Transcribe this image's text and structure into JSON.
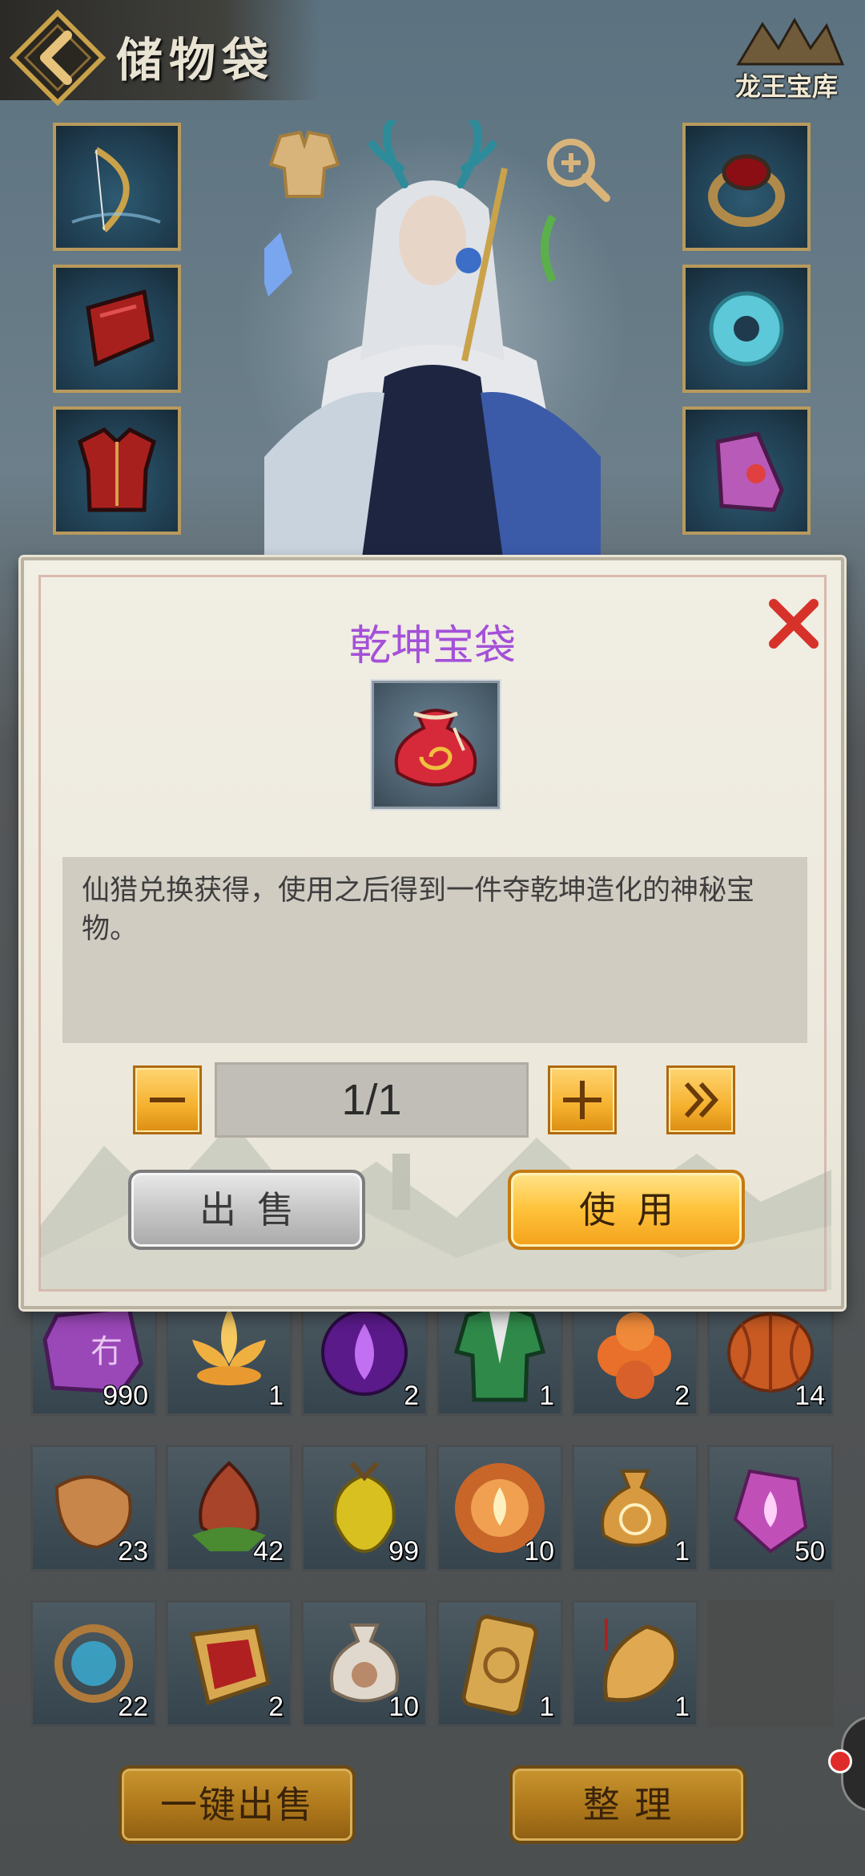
{
  "header": {
    "title": "储物袋",
    "logo_text": "龙王宝库"
  },
  "equipment": {
    "left_slots": [
      "bow-icon",
      "red-bracer-icon",
      "red-armor-icon"
    ],
    "right_slots": [
      "ruby-ring-icon",
      "jade-disc-icon",
      "purple-boot-icon"
    ]
  },
  "inventory": {
    "rows": [
      [
        {
          "icon": "purple-rune-stone-icon",
          "count": "990"
        },
        {
          "icon": "golden-lotus-icon",
          "count": "1"
        },
        {
          "icon": "purple-flame-orb-icon",
          "count": "2"
        },
        {
          "icon": "green-robe-icon",
          "count": "1"
        },
        {
          "icon": "orange-fruit-cluster-icon",
          "count": "2"
        },
        {
          "icon": "orange-seed-pod-icon",
          "count": "14"
        }
      ],
      [
        {
          "icon": "sweet-potato-icon",
          "count": "23"
        },
        {
          "icon": "red-bud-fruit-icon",
          "count": "42"
        },
        {
          "icon": "yellow-carambola-icon",
          "count": "99"
        },
        {
          "icon": "fire-orb-icon",
          "count": "10"
        },
        {
          "icon": "gold-pouch-icon",
          "count": "1"
        },
        {
          "icon": "purple-crystal-icon",
          "count": "50"
        }
      ],
      [
        {
          "icon": "blue-spirit-ring-icon",
          "count": "22"
        },
        {
          "icon": "red-token-icon",
          "count": "2"
        },
        {
          "icon": "white-pouch-icon",
          "count": "10"
        },
        {
          "icon": "gold-talisman-icon",
          "count": "1"
        },
        {
          "icon": "gold-amulet-icon",
          "count": "1"
        },
        {
          "icon": "",
          "count": ""
        }
      ]
    ]
  },
  "bottom_buttons": {
    "sell_all": "一键出售",
    "sort": "整 理"
  },
  "modal": {
    "title": "乾坤宝袋",
    "item_icon": "red-treasure-bag-icon",
    "description": "仙猎兑换获得，使用之后得到一件夺乾坤造化的神秘宝物。",
    "quantity": "1/1",
    "sell_label": "出售",
    "use_label": "使用"
  },
  "colors": {
    "title_purple": "#a450d8",
    "gold": "#f5b12e",
    "close_red": "#d6322a"
  }
}
